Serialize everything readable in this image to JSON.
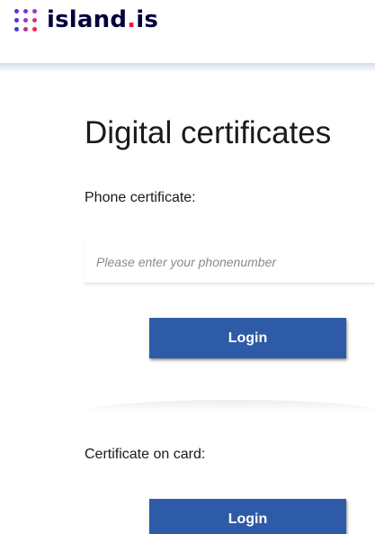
{
  "header": {
    "logo_text": "island",
    "logo_dot": ".",
    "logo_suffix": "is"
  },
  "main": {
    "title": "Digital certificates",
    "phone_section": {
      "label": "Phone certificate:",
      "placeholder": "Please enter your phonenumber",
      "login_label": "Login"
    },
    "card_section": {
      "label": "Certificate on card:",
      "login_label": "Login"
    }
  },
  "colors": {
    "brand_navy": "#00003c",
    "brand_red": "#ff0050",
    "button_blue": "#2e5ba7"
  }
}
